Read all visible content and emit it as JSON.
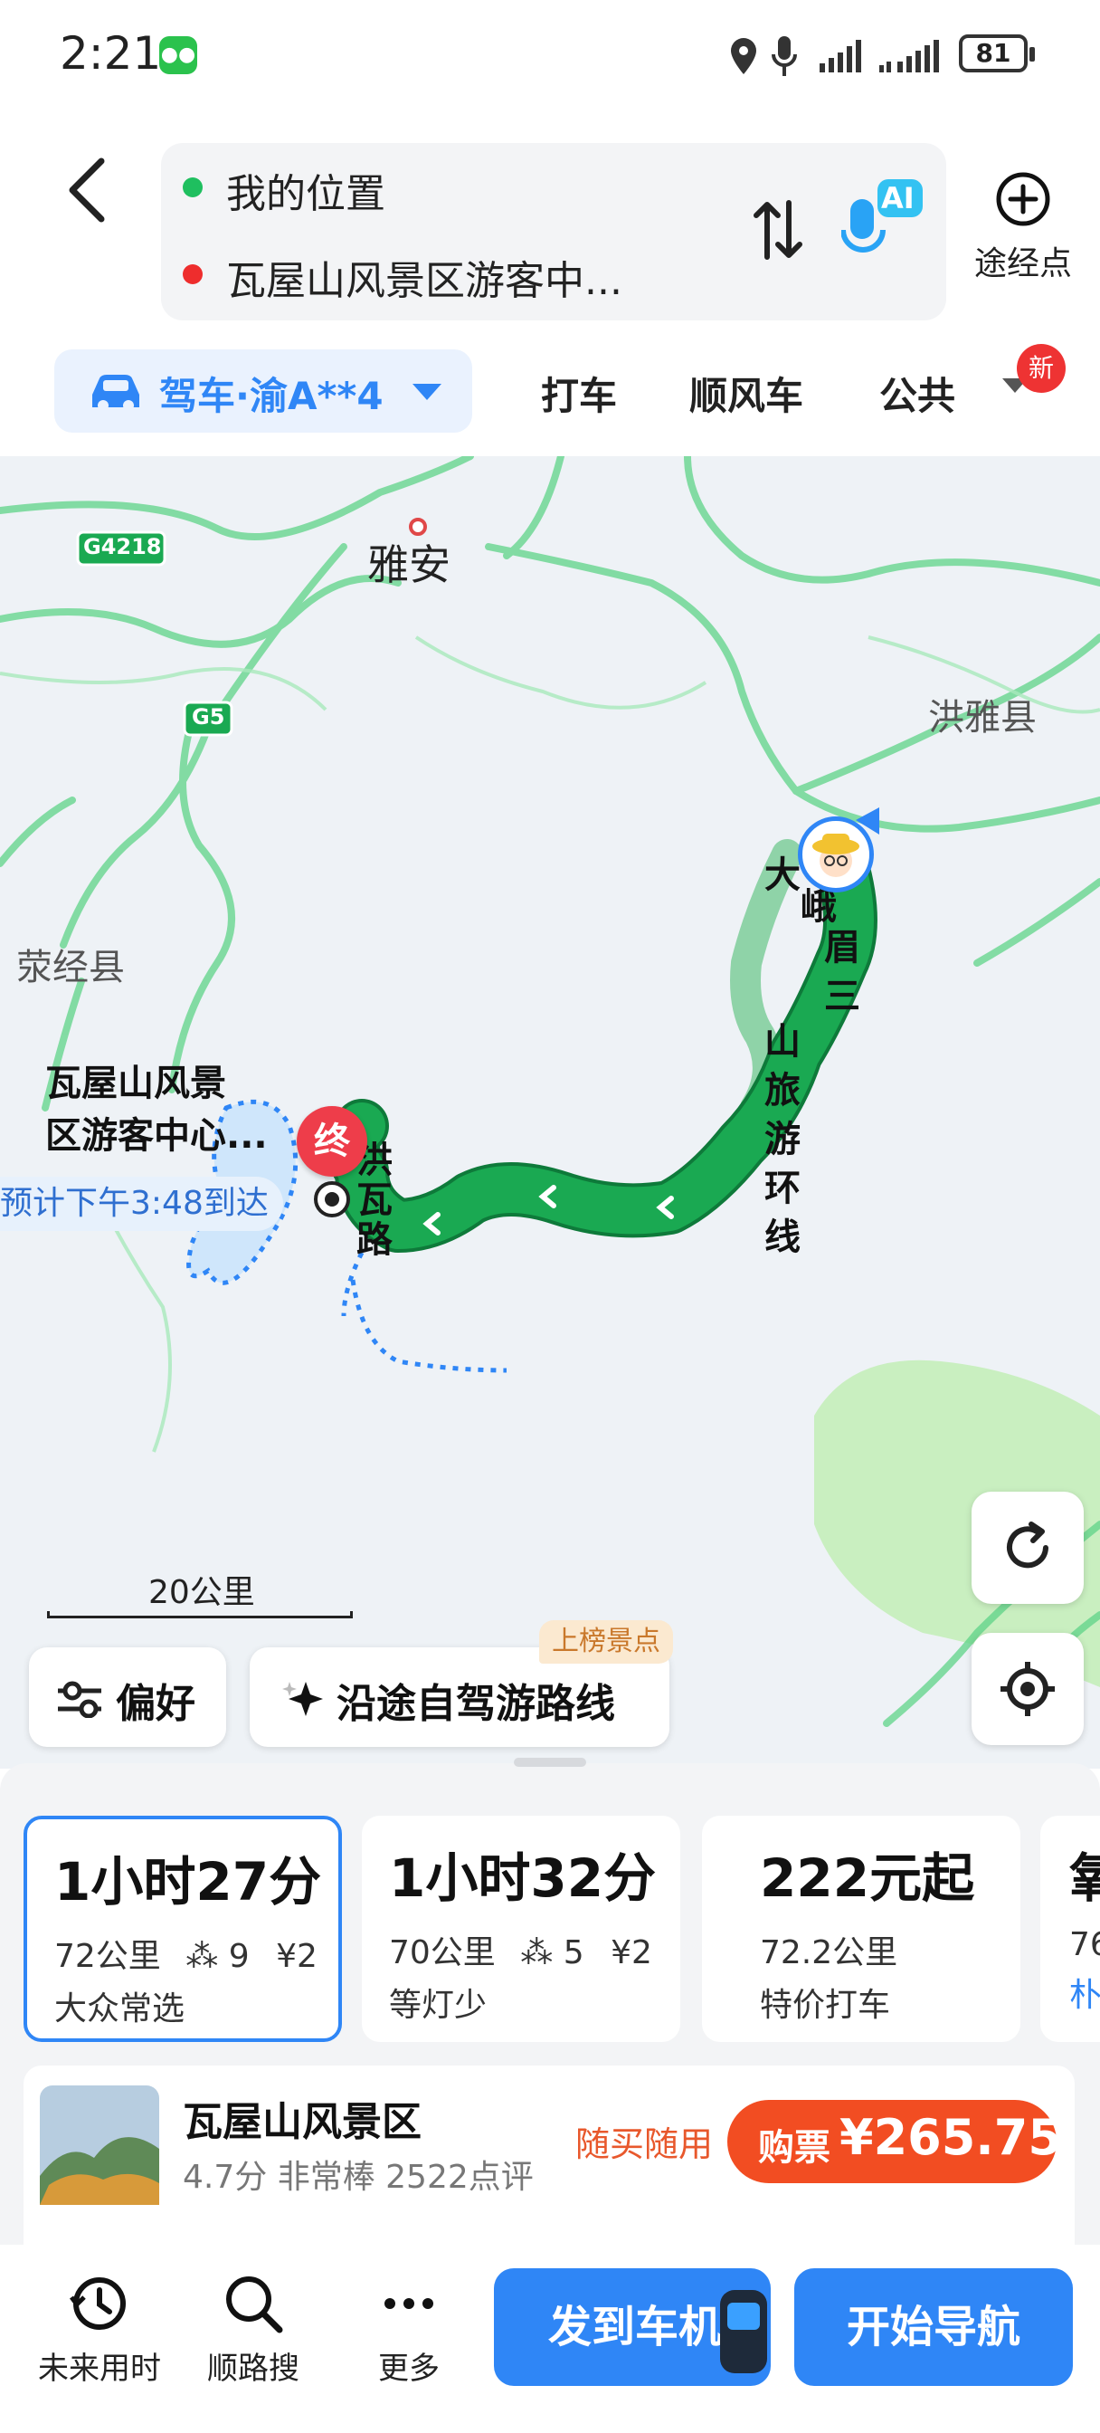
{
  "status": {
    "time": "2:21",
    "battery": "81"
  },
  "route": {
    "origin": "我的位置",
    "destination": "瓦屋山风景区游客中...",
    "ai_badge": "AI",
    "via_label": "途经点"
  },
  "modes": {
    "active": "驾车·渝A**4",
    "tabs": [
      "打车",
      "顺风车",
      "公共"
    ],
    "new_badge": "新"
  },
  "map": {
    "places": {
      "yaan": "雅安",
      "hongya": "洪雅县",
      "yingjing": "荥经县",
      "g4218": "G4218",
      "g5": "G5"
    },
    "road_names": {
      "loop": [
        "大",
        "峨",
        "眉",
        "三",
        "山",
        "旅",
        "游",
        "环",
        "线"
      ],
      "hongwa": [
        "洪",
        "瓦",
        "路"
      ]
    },
    "destination_label_1": "瓦屋山风景",
    "destination_label_2": "区游客中心...",
    "end_marker": "终",
    "eta": "预计下午3:48到达",
    "scale": "20公里",
    "prefs_button": "偏好",
    "selfdrive_button": "沿途自驾游路线",
    "selfdrive_tag": "上榜景点",
    "colors": {
      "route": "#1aa952",
      "route_outline": "#0e7a3a",
      "road": "#5fd488",
      "water": "#cfe6fb"
    }
  },
  "routes": [
    {
      "duration": "1小时27分",
      "distance": "72公里",
      "lights": "9",
      "toll": "¥2",
      "tag": "大众常选",
      "selected": true
    },
    {
      "duration": "1小时32分",
      "distance": "70公里",
      "lights": "5",
      "toll": "¥2",
      "tag": "等灯少",
      "selected": false
    },
    {
      "duration": "222元起",
      "distance": "72.2公里",
      "tag": "特价打车",
      "selected": false
    },
    {
      "duration": "氧",
      "distance": "76",
      "tag": "朴"
    }
  ],
  "scenic": {
    "name": "瓦屋山风景区",
    "rating": "4.7分 非常棒 2522点评",
    "promo": "随买随用",
    "buy_label": "购票",
    "price": "¥265.75"
  },
  "bottom": {
    "future_time": "未来用时",
    "along_search": "顺路搜",
    "more": "更多",
    "send_car": "发到车机",
    "start_nav": "开始导航"
  }
}
